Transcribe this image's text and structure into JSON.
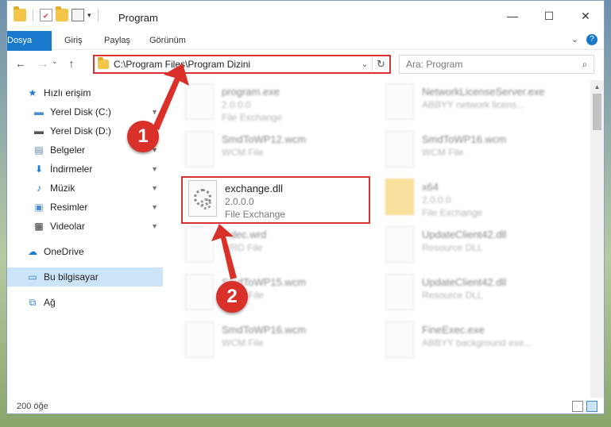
{
  "window": {
    "title": "Program",
    "controls": {
      "minimize": "—",
      "maximize": "☐",
      "close": "✕"
    }
  },
  "ribbon": {
    "tabs": [
      "Dosya",
      "Giriş",
      "Paylaş",
      "Görünüm"
    ],
    "expand": "⌄",
    "help": "?"
  },
  "nav": {
    "back": "←",
    "forward": "→",
    "recent": "⌄",
    "up": "↑",
    "address": "C:\\Program Files\\Program Dizini",
    "address_chevron": "⌄",
    "refresh": "↻",
    "search_placeholder": "Ara: Program",
    "search_icon": "⌕"
  },
  "sidebar": {
    "items": [
      {
        "label": "Hızlı erişim",
        "icon": "star-icon",
        "glyph": "★",
        "color": "#1979ca"
      },
      {
        "label": "Yerel Disk (C:)",
        "icon": "drive-icon",
        "glyph": "▬",
        "color": "#4a8fd8",
        "pin": "📌"
      },
      {
        "label": "Yerel Disk (D:)",
        "icon": "drive-icon",
        "glyph": "▬",
        "color": "#555555",
        "pin": "📌"
      },
      {
        "label": "Belgeler",
        "icon": "documents-icon",
        "glyph": "▤",
        "color": "#5a7fa8",
        "pin": "📌"
      },
      {
        "label": "İndirmeler",
        "icon": "download-icon",
        "glyph": "⬇",
        "color": "#1979ca",
        "pin": "📌"
      },
      {
        "label": "Müzik",
        "icon": "music-icon",
        "glyph": "♪",
        "color": "#1979ca",
        "pin": "📌"
      },
      {
        "label": "Resimler",
        "icon": "pictures-icon",
        "glyph": "▣",
        "color": "#4a8fd8",
        "pin": "📌"
      },
      {
        "label": "Videolar",
        "icon": "video-icon",
        "glyph": "▦",
        "color": "#333333",
        "pin": "📌"
      },
      {
        "label": "OneDrive",
        "icon": "cloud-icon",
        "glyph": "☁",
        "color": "#1979ca"
      },
      {
        "label": "Bu bilgisayar",
        "icon": "computer-icon",
        "glyph": "▭",
        "color": "#2a7ad8"
      },
      {
        "label": "Ağ",
        "icon": "network-icon",
        "glyph": "⧉",
        "color": "#2a7ad8"
      }
    ]
  },
  "files": {
    "left": [
      {
        "name": "program.exe",
        "line1": "2.0.0.0",
        "line2": "File Exchange"
      },
      {
        "name": "SmdToWP12.wcm",
        "line1": "WCM File",
        "line2": ""
      },
      {
        "name": "exchange.dll",
        "line1": "2.0.0.0",
        "line2": "File Exchange"
      },
      {
        "name": "Fidec.wrd",
        "line1": "WRD File",
        "line2": ""
      },
      {
        "name": "SmdToWP15.wcm",
        "line1": "WCM File",
        "line2": ""
      },
      {
        "name": "SmdToWP16.wcm",
        "line1": "WCM File",
        "line2": ""
      }
    ],
    "right": [
      {
        "name": "NetworkLicenseServer.exe",
        "line1": "ABBYY network licens...",
        "line2": ""
      },
      {
        "name": "SmdToWP16.wcm",
        "line1": "WCM File",
        "line2": ""
      },
      {
        "name": "x64",
        "line1": "2.0.0.0",
        "line2": "File Exchange"
      },
      {
        "name": "UpdateClient42.dll",
        "line1": "Resource DLL",
        "line2": ""
      },
      {
        "name": "UpdateClient42.dll",
        "line1": "Resource DLL",
        "line2": ""
      },
      {
        "name": "FineExec.exe",
        "line1": "ABBYY background exe...",
        "line2": ""
      }
    ]
  },
  "status": {
    "count": "200 öğe"
  },
  "annotations": {
    "step1": "1",
    "step2": "2",
    "accent": "#d9302a"
  }
}
